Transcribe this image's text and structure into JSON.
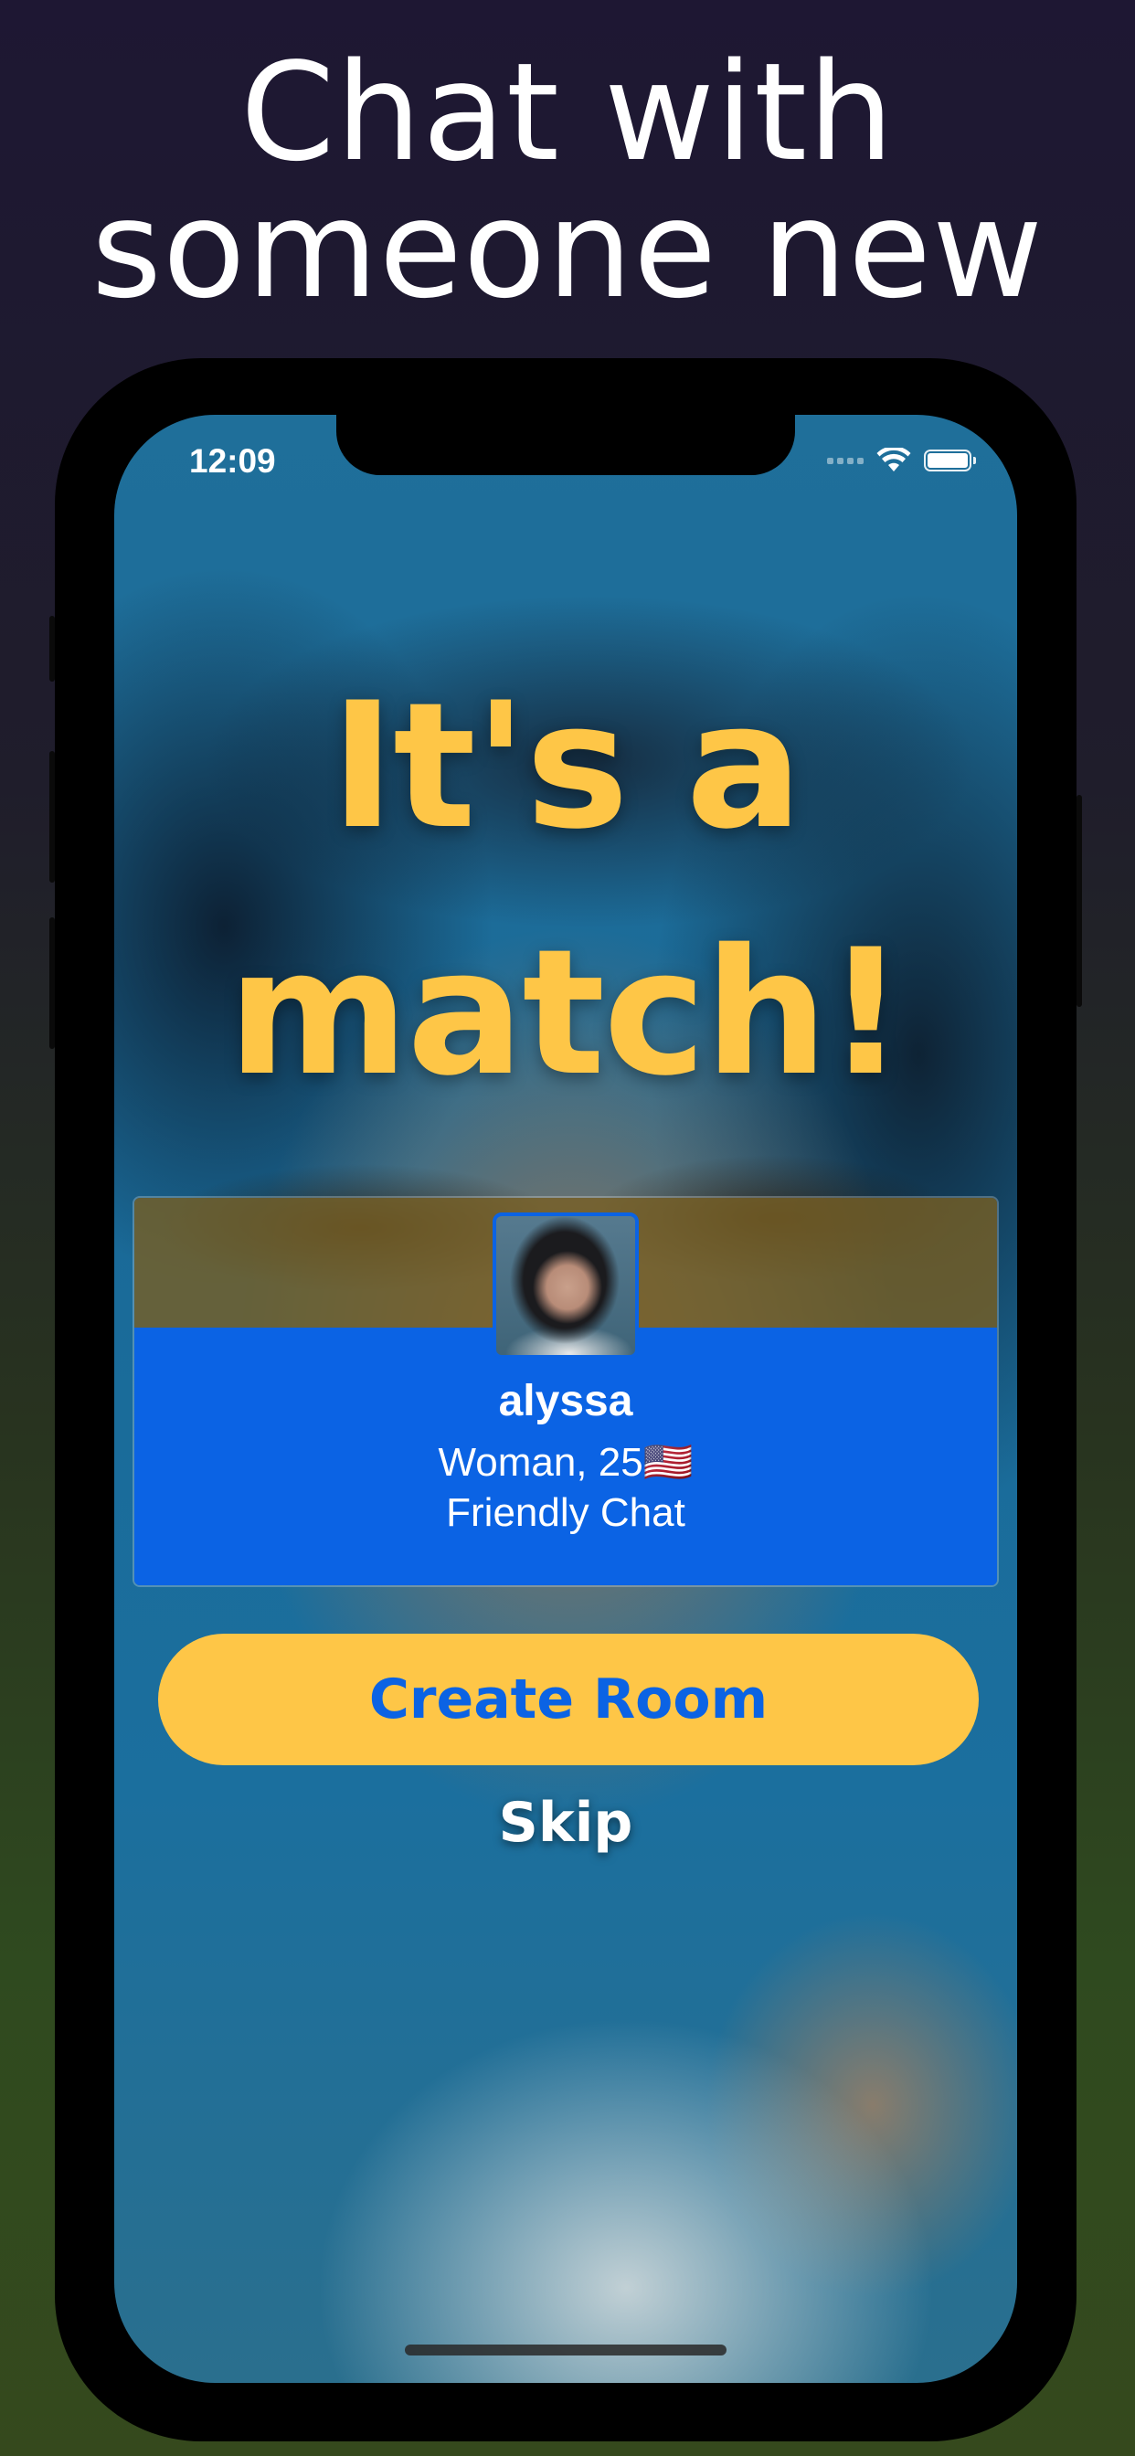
{
  "headline": {
    "line1": "Chat with",
    "line2": "someone new"
  },
  "status_bar": {
    "time": "12:09",
    "icons": [
      "cellular-signal-icon",
      "wifi-icon",
      "battery-icon"
    ],
    "battery_level": 1.0
  },
  "match": {
    "title_line1": "It's a",
    "title_line2": "match!"
  },
  "profile_card": {
    "name": "alyssa",
    "details": "Woman, 25🇺🇸",
    "chat_type": "Friendly Chat"
  },
  "actions": {
    "create_room_label": "Create Room",
    "skip_label": "Skip"
  },
  "colors": {
    "accent_yellow": "#fec647",
    "accent_blue": "#0b63e4",
    "text_white": "#ffffff"
  }
}
